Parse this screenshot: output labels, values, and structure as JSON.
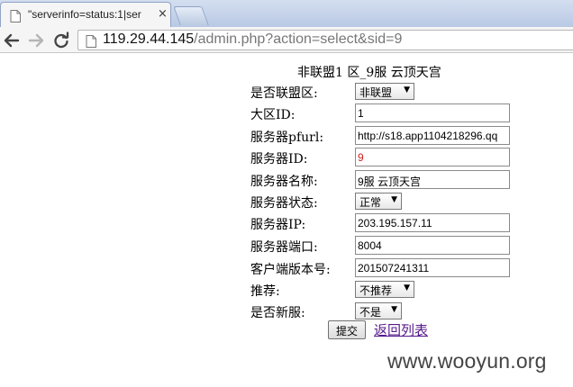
{
  "tab": {
    "title": "\"serverinfo=status:1|ser",
    "close": "×"
  },
  "address_bar": {
    "host": "119.29.44.145",
    "path": "/admin.php?action=select&sid=9"
  },
  "page": {
    "heading": "非联盟1 区_9服 云顶天宫",
    "fields": [
      {
        "label": "是否联盟区:",
        "type": "select",
        "value": "非联盟"
      },
      {
        "label": "大区ID:",
        "type": "text",
        "value": "1"
      },
      {
        "label": "服务器pfurl:",
        "type": "text",
        "value": "http://s18.app1104218296.qq"
      },
      {
        "label": "服务器ID:",
        "type": "text",
        "value": "9"
      },
      {
        "label": "服务器名称:",
        "type": "text",
        "value": "9服 云顶天宫"
      },
      {
        "label": "服务器状态:",
        "type": "select",
        "value": "正常"
      },
      {
        "label": "服务器IP:",
        "type": "text",
        "value": "203.195.157.11"
      },
      {
        "label": "服务器端口:",
        "type": "text",
        "value": "8004"
      },
      {
        "label": "客户端版本号:",
        "type": "text",
        "value": "201507241311"
      },
      {
        "label": "推荐:",
        "type": "select",
        "value": "不推荐"
      },
      {
        "label": "是否新服:",
        "type": "select",
        "value": "不是"
      }
    ],
    "submit_label": "提交",
    "back_link": "返回列表"
  },
  "watermark": "www.wooyun.org",
  "colors": {
    "tabstrip": "#c9d6ea",
    "link_visited": "#551a8b",
    "server_id_text": "#d02020"
  }
}
